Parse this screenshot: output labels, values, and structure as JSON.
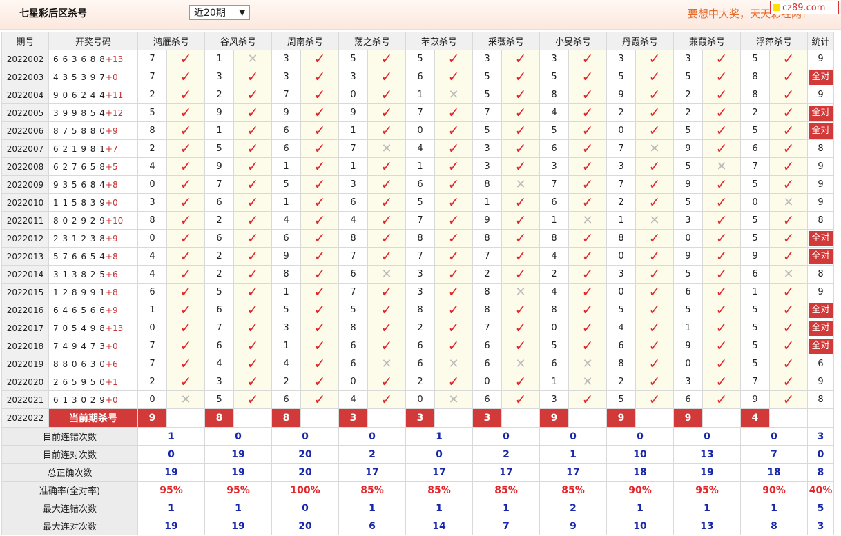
{
  "header": {
    "title": "七星彩后区杀号",
    "period_selected": "近20期",
    "slogan": "要想中大奖，天天彩经网！",
    "logo_text": "cz89.com"
  },
  "columns": {
    "issue": "期号",
    "draw": "开奖号码",
    "experts": [
      "鸿雁杀号",
      "谷风杀号",
      "周南杀号",
      "荡之杀号",
      "芣苡杀号",
      "采薇杀号",
      "小旻杀号",
      "丹霞杀号",
      "蒹葭杀号",
      "浮萍杀号"
    ],
    "stat": "统计"
  },
  "rows": [
    {
      "issue": "2022002",
      "draw": "6 6 3 6 8 8",
      "extra": "+13",
      "kills": [
        "7",
        "1",
        "3",
        "5",
        "5",
        "3",
        "3",
        "3",
        "3",
        "5"
      ],
      "results": [
        1,
        0,
        1,
        1,
        1,
        1,
        1,
        1,
        1,
        1
      ],
      "stat": "9"
    },
    {
      "issue": "2022003",
      "draw": "4 3 5 3 9 7",
      "extra": "+0",
      "kills": [
        "7",
        "3",
        "3",
        "3",
        "6",
        "5",
        "5",
        "5",
        "5",
        "8"
      ],
      "results": [
        1,
        1,
        1,
        1,
        1,
        1,
        1,
        1,
        1,
        1
      ],
      "stat": "全对"
    },
    {
      "issue": "2022004",
      "draw": "9 0 6 2 4 4",
      "extra": "+11",
      "kills": [
        "2",
        "2",
        "7",
        "0",
        "1",
        "5",
        "8",
        "9",
        "2",
        "8"
      ],
      "results": [
        1,
        1,
        1,
        1,
        0,
        1,
        1,
        1,
        1,
        1
      ],
      "stat": "9"
    },
    {
      "issue": "2022005",
      "draw": "3 9 9 8 5 4",
      "extra": "+12",
      "kills": [
        "5",
        "9",
        "9",
        "9",
        "7",
        "7",
        "4",
        "2",
        "2",
        "2"
      ],
      "results": [
        1,
        1,
        1,
        1,
        1,
        1,
        1,
        1,
        1,
        1
      ],
      "stat": "全对"
    },
    {
      "issue": "2022006",
      "draw": "8 7 5 8 8 0",
      "extra": "+9",
      "kills": [
        "8",
        "1",
        "6",
        "1",
        "0",
        "5",
        "5",
        "0",
        "5",
        "5"
      ],
      "results": [
        1,
        1,
        1,
        1,
        1,
        1,
        1,
        1,
        1,
        1
      ],
      "stat": "全对"
    },
    {
      "issue": "2022007",
      "draw": "6 2 1 9 8 1",
      "extra": "+7",
      "kills": [
        "2",
        "5",
        "6",
        "7",
        "4",
        "3",
        "6",
        "7",
        "9",
        "6"
      ],
      "results": [
        1,
        1,
        1,
        0,
        1,
        1,
        1,
        0,
        1,
        1
      ],
      "stat": "8"
    },
    {
      "issue": "2022008",
      "draw": "6 2 7 6 5 8",
      "extra": "+5",
      "kills": [
        "4",
        "9",
        "1",
        "1",
        "1",
        "3",
        "3",
        "3",
        "5",
        "7"
      ],
      "results": [
        1,
        1,
        1,
        1,
        1,
        1,
        1,
        1,
        0,
        1
      ],
      "stat": "9"
    },
    {
      "issue": "2022009",
      "draw": "9 3 5 6 8 4",
      "extra": "+8",
      "kills": [
        "0",
        "7",
        "5",
        "3",
        "6",
        "8",
        "7",
        "7",
        "9",
        "5"
      ],
      "results": [
        1,
        1,
        1,
        1,
        1,
        0,
        1,
        1,
        1,
        1
      ],
      "stat": "9"
    },
    {
      "issue": "2022010",
      "draw": "1 1 5 8 3 9",
      "extra": "+0",
      "kills": [
        "3",
        "6",
        "1",
        "6",
        "5",
        "1",
        "6",
        "2",
        "5",
        "0"
      ],
      "results": [
        1,
        1,
        1,
        1,
        1,
        1,
        1,
        1,
        1,
        0
      ],
      "stat": "9"
    },
    {
      "issue": "2022011",
      "draw": "8 0 2 9 2 9",
      "extra": "+10",
      "kills": [
        "8",
        "2",
        "4",
        "4",
        "7",
        "9",
        "1",
        "1",
        "3",
        "5"
      ],
      "results": [
        1,
        1,
        1,
        1,
        1,
        1,
        0,
        0,
        1,
        1
      ],
      "stat": "8"
    },
    {
      "issue": "2022012",
      "draw": "2 3 1 2 3 8",
      "extra": "+9",
      "kills": [
        "0",
        "6",
        "6",
        "8",
        "8",
        "8",
        "8",
        "8",
        "0",
        "5"
      ],
      "results": [
        1,
        1,
        1,
        1,
        1,
        1,
        1,
        1,
        1,
        1
      ],
      "stat": "全对"
    },
    {
      "issue": "2022013",
      "draw": "5 7 6 6 5 4",
      "extra": "+8",
      "kills": [
        "4",
        "2",
        "9",
        "7",
        "7",
        "7",
        "4",
        "0",
        "9",
        "9"
      ],
      "results": [
        1,
        1,
        1,
        1,
        1,
        1,
        1,
        1,
        1,
        1
      ],
      "stat": "全对"
    },
    {
      "issue": "2022014",
      "draw": "3 1 3 8 2 5",
      "extra": "+6",
      "kills": [
        "4",
        "2",
        "8",
        "6",
        "3",
        "2",
        "2",
        "3",
        "5",
        "6"
      ],
      "results": [
        1,
        1,
        1,
        0,
        1,
        1,
        1,
        1,
        1,
        0
      ],
      "stat": "8"
    },
    {
      "issue": "2022015",
      "draw": "1 2 8 9 9 1",
      "extra": "+8",
      "kills": [
        "6",
        "5",
        "1",
        "7",
        "3",
        "8",
        "4",
        "0",
        "6",
        "1"
      ],
      "results": [
        1,
        1,
        1,
        1,
        1,
        0,
        1,
        1,
        1,
        1
      ],
      "stat": "9"
    },
    {
      "issue": "2022016",
      "draw": "6 4 6 5 6 6",
      "extra": "+9",
      "kills": [
        "1",
        "6",
        "5",
        "5",
        "8",
        "8",
        "8",
        "5",
        "5",
        "5"
      ],
      "results": [
        1,
        1,
        1,
        1,
        1,
        1,
        1,
        1,
        1,
        1
      ],
      "stat": "全对"
    },
    {
      "issue": "2022017",
      "draw": "7 0 5 4 9 8",
      "extra": "+13",
      "kills": [
        "0",
        "7",
        "3",
        "8",
        "2",
        "7",
        "0",
        "4",
        "1",
        "5"
      ],
      "results": [
        1,
        1,
        1,
        1,
        1,
        1,
        1,
        1,
        1,
        1
      ],
      "stat": "全对"
    },
    {
      "issue": "2022018",
      "draw": "7 4 9 4 7 3",
      "extra": "+0",
      "kills": [
        "7",
        "6",
        "1",
        "6",
        "6",
        "6",
        "5",
        "6",
        "9",
        "5"
      ],
      "results": [
        1,
        1,
        1,
        1,
        1,
        1,
        1,
        1,
        1,
        1
      ],
      "stat": "全对"
    },
    {
      "issue": "2022019",
      "draw": "8 8 0 6 3 0",
      "extra": "+6",
      "kills": [
        "7",
        "4",
        "4",
        "6",
        "6",
        "6",
        "6",
        "8",
        "0",
        "5"
      ],
      "results": [
        1,
        1,
        1,
        0,
        0,
        0,
        0,
        1,
        1,
        1
      ],
      "stat": "6"
    },
    {
      "issue": "2022020",
      "draw": "2 6 5 9 5 0",
      "extra": "+1",
      "kills": [
        "2",
        "3",
        "2",
        "0",
        "2",
        "0",
        "1",
        "2",
        "3",
        "7"
      ],
      "results": [
        1,
        1,
        1,
        1,
        1,
        1,
        0,
        1,
        1,
        1
      ],
      "stat": "9"
    },
    {
      "issue": "2022021",
      "draw": "6 1 3 0 2 9",
      "extra": "+0",
      "kills": [
        "0",
        "5",
        "6",
        "4",
        "0",
        "6",
        "3",
        "5",
        "6",
        "9"
      ],
      "results": [
        0,
        1,
        1,
        1,
        0,
        1,
        1,
        1,
        1,
        1
      ],
      "stat": "8"
    }
  ],
  "current": {
    "issue": "2022022",
    "label": "当前期杀号",
    "kills": [
      "9",
      "8",
      "8",
      "3",
      "3",
      "3",
      "9",
      "9",
      "9",
      "4"
    ]
  },
  "stats": [
    {
      "label": "目前连错次数",
      "values": [
        "1",
        "0",
        "0",
        "0",
        "1",
        "0",
        "0",
        "0",
        "0",
        "0"
      ],
      "total": "3"
    },
    {
      "label": "目前连对次数",
      "values": [
        "0",
        "19",
        "20",
        "2",
        "0",
        "2",
        "1",
        "10",
        "13",
        "7"
      ],
      "total": "0"
    },
    {
      "label": "总正确次数",
      "values": [
        "19",
        "19",
        "20",
        "17",
        "17",
        "17",
        "17",
        "18",
        "19",
        "18"
      ],
      "total": "8"
    },
    {
      "label": "准确率(全对率)",
      "values": [
        "95%",
        "95%",
        "100%",
        "85%",
        "85%",
        "85%",
        "85%",
        "90%",
        "95%",
        "90%"
      ],
      "total": "40%"
    },
    {
      "label": "最大连错次数",
      "values": [
        "1",
        "1",
        "0",
        "1",
        "1",
        "1",
        "2",
        "1",
        "1",
        "1"
      ],
      "total": "5"
    },
    {
      "label": "最大连对次数",
      "values": [
        "19",
        "19",
        "20",
        "6",
        "14",
        "7",
        "9",
        "10",
        "13",
        "8"
      ],
      "total": "3"
    }
  ],
  "colors": {
    "accent_red": "#d23a3a",
    "stat_blue": "#1727a8",
    "slogan_orange": "#e76a2a"
  },
  "icons": {
    "correct": "check-icon",
    "wrong": "cross-icon"
  }
}
